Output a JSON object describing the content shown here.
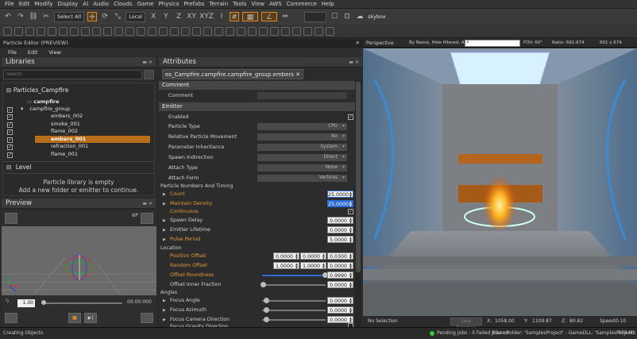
{
  "menu": [
    "File",
    "Edit",
    "Modify",
    "Display",
    "AI",
    "Audio",
    "Clouds",
    "Game",
    "Physics",
    "Prefabs",
    "Terrain",
    "Tools",
    "View",
    "AWS",
    "Commerce",
    "Help"
  ],
  "toolbar": {
    "select_all": "Select All",
    "coord_system": "Local",
    "axis_x": "X",
    "axis_y": "Y",
    "axis_z": "Z",
    "axis_xy": "XY",
    "axis_xyz": "XYZ",
    "skybox": "skybox"
  },
  "editor": {
    "title": "Particle Editor (PREVIEW)",
    "menu": [
      "File",
      "Edit",
      "View"
    ]
  },
  "libraries": {
    "header": "Libraries",
    "search_placeholder": "Search",
    "group_name": "Particles_Campfire",
    "tree": {
      "root": "campfire",
      "group": "campfire_group",
      "items": [
        "embers_002",
        "smoke_001",
        "flame_002",
        "embers_001",
        "refraction_001",
        "flame_001"
      ],
      "selected": "embers_001"
    },
    "level_label": "Level",
    "empty_msg1": "Particle library is empty",
    "empty_msg2": "Add a new folder or emitter to continue."
  },
  "preview": {
    "header": "Preview",
    "count": "6P",
    "speed": "1.00",
    "time": "00:00:000"
  },
  "attributes": {
    "header": "Attributes",
    "tab": "es_Campfire.campfire.campfire_group.embers",
    "comment_section": "Comment",
    "comment_label": "Comment",
    "emitter_section": "Emitter",
    "enabled": "Enabled",
    "particle_type": "Particle Type",
    "particle_type_val": "CPU",
    "rel_movement": "Relative Particle Movement",
    "rel_movement_val": "No",
    "param_inherit": "Parameter Inheritance",
    "param_inherit_val": "System",
    "spawn_indir": "Spawn Indirection",
    "spawn_indir_val": "Direct",
    "attach_type": "Attach Type",
    "attach_type_val": "None",
    "attach_form": "Attach Form",
    "attach_form_val": "Vertices",
    "numbers_timing": "Particle Numbers And Timing",
    "count": "Count",
    "count_val": "25.0000",
    "maintain_density": "Maintain Density",
    "maintain_density_val": "25.0000",
    "continuous": "Continuous",
    "spawn_delay": "Spawn Delay",
    "spawn_delay_val": "0.0000",
    "emitter_lifetime": "Emitter Lifetime",
    "emitter_lifetime_val": "0.0000",
    "pulse_period": "Pulse Period",
    "pulse_period_val": "5.0000",
    "location": "Location",
    "position_offset": "Position Offset",
    "position_offset_vals": [
      "0.0000",
      "0.0000",
      "0.0300"
    ],
    "random_offset": "Random Offset",
    "random_offset_vals": [
      "1.0000",
      "1.0000",
      "0.0000"
    ],
    "offset_roundness": "Offset Roundness",
    "offset_roundness_val": "0.9990",
    "offset_inner": "Offset Inner Fraction",
    "offset_inner_val": "0.0000",
    "angles": "Angles",
    "focus_angle": "Focus Angle",
    "focus_angle_val": "0.0000",
    "focus_azimuth": "Focus Azimuth",
    "focus_azimuth_val": "0.0000",
    "focus_cam_dir": "Focus Camera Direction",
    "focus_cam_dir_val": "0.0000",
    "focus_grav_dir": "Focus Gravity Direction"
  },
  "viewport": {
    "label": "Perspective",
    "filter": "By Name, Hide filtered, AND",
    "fov": "FOV: 60°",
    "ratio": "Ratio: 691:674",
    "size": "691 x 674",
    "no_selection": "No Selection",
    "lock_selection": "Lock Selection",
    "x_label": "X:",
    "x_val": "1058.00",
    "y_label": "Y:",
    "y_val": "1109.87",
    "z_label": "Z:",
    "z_val": "80.82",
    "speed_label": "Speed:",
    "speed_val": "0.10"
  },
  "status": {
    "left": "Creating Objects",
    "jobs": "Pending Jobs : 0  Failed Jobs : 0",
    "folders": "GameFolder: 'SamplesProject' - GameDLL: 'SamplesProject'",
    "memory": "974 Mb"
  },
  "colors": {
    "accent": "#e59a36",
    "selection": "#b86f1c",
    "blue_edit": "#2c6bd6"
  }
}
